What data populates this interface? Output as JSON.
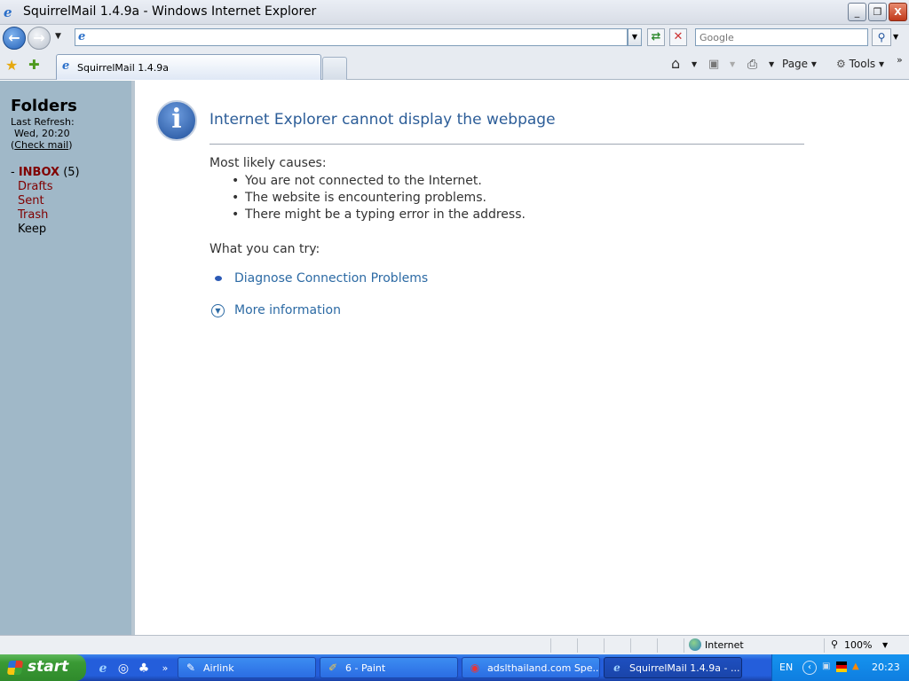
{
  "window": {
    "title": "SquirrelMail 1.4.9a - Windows Internet Explorer",
    "min_label": "_",
    "max_label": "❐",
    "close_label": "X"
  },
  "addressbar": {
    "url": "",
    "search_placeholder": "Google"
  },
  "tabs": {
    "active_label": "SquirrelMail 1.4.9a"
  },
  "toolbar": {
    "page_label": "Page ▾",
    "tools_label": "Tools ▾",
    "more": "»"
  },
  "sidebar": {
    "heading": "Folders",
    "last_refresh": "Last Refresh:",
    "date": "Wed, 20:20",
    "check_pre": "(",
    "check_link": "Check mail",
    "check_post": ")",
    "inbox_prefix": "- ",
    "inbox": "INBOX",
    "inbox_count": " (5)",
    "folders": [
      "Drafts",
      "Sent",
      "Trash",
      "Keep"
    ]
  },
  "error": {
    "title": "Internet Explorer cannot display the webpage",
    "causes_heading": "Most likely causes:",
    "causes": [
      "You are not connected to the Internet.",
      "The website is encountering problems.",
      "There might be a typing error in the address."
    ],
    "try_heading": "What you can try:",
    "diagnose_link": "Diagnose Connection Problems",
    "more_info_link": "More information"
  },
  "statusbar": {
    "zone": "Internet",
    "zoom": "100%"
  },
  "taskbar": {
    "start": "start",
    "tasks": [
      "Airlink",
      "6 - Paint",
      "adslthailand.com Spe...",
      "SquirrelMail 1.4.9a - ..."
    ],
    "lang": "EN",
    "clock": "20:23"
  },
  "colors": {
    "sidebar_bg": "#a0b8c8",
    "folder_link": "#800000",
    "error_title": "#2c5d98",
    "link": "#2c6aa4",
    "taskbar": "#245edb",
    "start_green": "#3a9a35"
  }
}
